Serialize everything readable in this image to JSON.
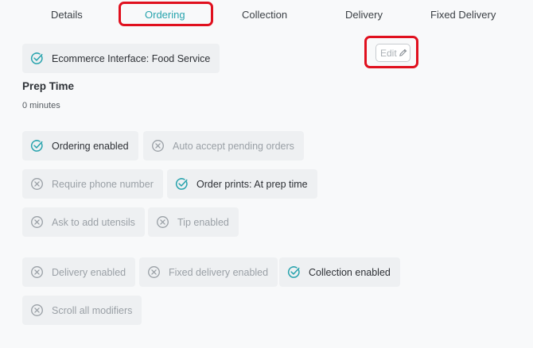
{
  "tabs": [
    {
      "label": "Details"
    },
    {
      "label": "Ordering",
      "active": true
    },
    {
      "label": "Collection"
    },
    {
      "label": "Delivery"
    },
    {
      "label": "Fixed Delivery"
    }
  ],
  "interface_chip": {
    "label": "Ecommerce Interface: Food Service",
    "enabled": true
  },
  "edit_button": {
    "label": "Edit"
  },
  "prep_time": {
    "heading": "Prep Time",
    "value": "0 minutes"
  },
  "settings": [
    {
      "label": "Ordering enabled",
      "enabled": true
    },
    {
      "label": "Auto accept pending orders",
      "enabled": false
    },
    {
      "label": "Require phone number",
      "enabled": false
    },
    {
      "label": "Order prints: At prep time",
      "enabled": true
    },
    {
      "label": "Ask to add utensils",
      "enabled": false
    },
    {
      "label": "Tip enabled",
      "enabled": false
    },
    {
      "label": "Delivery enabled",
      "enabled": false
    },
    {
      "label": "Fixed delivery enabled",
      "enabled": false
    },
    {
      "label": "Collection enabled",
      "enabled": true
    },
    {
      "label": "Scroll all modifiers",
      "enabled": false
    }
  ],
  "colors": {
    "accent": "#27a3ad",
    "highlight": "#e0101e",
    "disabled": "#9aa0a6"
  }
}
